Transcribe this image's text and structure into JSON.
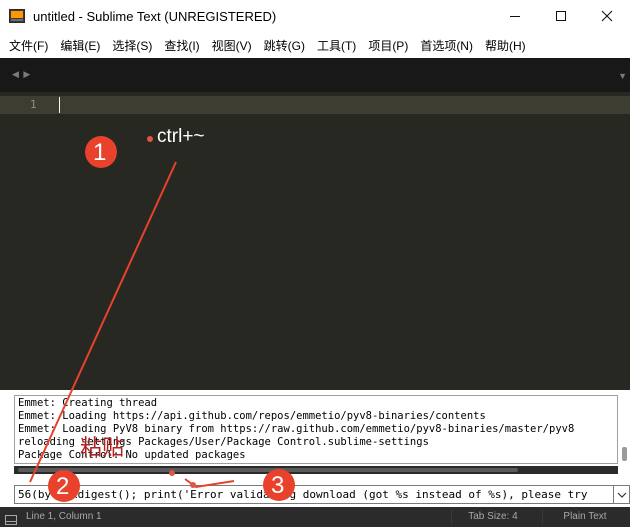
{
  "window": {
    "title": "untitled - Sublime Text (UNREGISTERED)",
    "minimize_icon": "minimize-icon",
    "maximize_icon": "maximize-icon",
    "close_icon": "close-icon"
  },
  "menu": [
    "文件(F)",
    "编辑(E)",
    "选择(S)",
    "查找(I)",
    "视图(V)",
    "跳转(G)",
    "工具(T)",
    "项目(P)",
    "首选项(N)",
    "帮助(H)"
  ],
  "tabbar": {
    "nav_arrows": "◀ ▶",
    "overflow_arrow": "▼"
  },
  "editor": {
    "line_number": "1",
    "content": "",
    "background_color": "#272822"
  },
  "console": {
    "output": "Emmet: Creating thread\nEmmet: Loading https://api.github.com/repos/emmetio/pyv8-binaries/contents\nEmmet: Loading PyV8 binary from https://raw.github.com/emmetio/pyv8-binaries/master/pyv8\nreloading settings Packages/User/Package Control.sublime-settings\nPackage Control: No updated packages",
    "input_value": "56(by.hexdigest(); print('Error validating download (got %s instead of %s), please try"
  },
  "status": {
    "position": "Line 1, Column 1",
    "tab_size": "Tab Size: 4",
    "syntax": "Plain Text"
  },
  "annotations": {
    "step1_number": "1",
    "step1_label": "ctrl+~",
    "step2_number": "2",
    "step2_label": "粘贴",
    "step3_number": "3",
    "circle_color": "#e8412c",
    "label_color": "#ffffff",
    "paste_label_color": "#b22222",
    "dot_color": "#e05545"
  }
}
